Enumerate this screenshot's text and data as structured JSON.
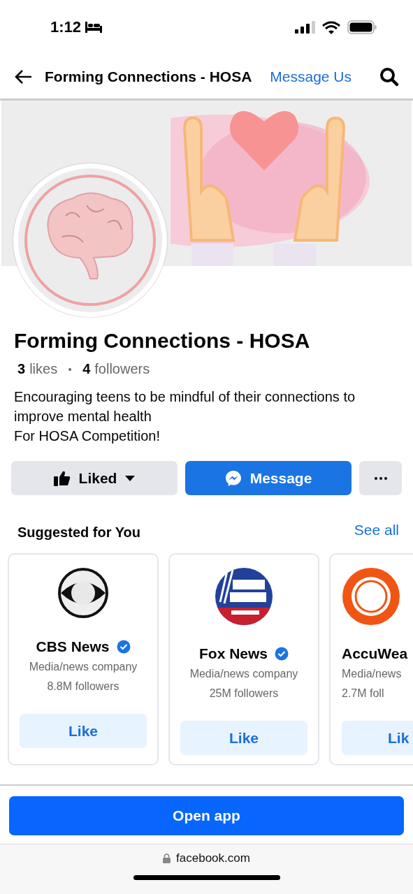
{
  "status_bar": {
    "time": "1:12"
  },
  "nav": {
    "title": "Forming Connections - HOSA",
    "action": "Message Us"
  },
  "profile": {
    "name": "Forming Connections - HOSA",
    "likes_count": "3",
    "likes_label": "likes",
    "followers_count": "4",
    "followers_label": "followers",
    "bio": [
      "Encouraging teens to be mindful of their connections to improve mental health",
      "For HOSA Competition!"
    ]
  },
  "actions": [
    {
      "kind": "liked",
      "label": "Liked"
    },
    {
      "kind": "message",
      "label": "Message"
    },
    {
      "kind": "more"
    }
  ],
  "suggested": {
    "title": "Suggested for You",
    "see_all": "See all",
    "cards": [
      {
        "kind": "full",
        "logo": {
          "kind": "eye"
        },
        "name": "CBS News",
        "verified": true,
        "category": "Media/news company",
        "followers": "8.8M followers",
        "button": "Like"
      },
      {
        "kind": "full",
        "logo": {
          "kind": "globe"
        },
        "name": "Fox News",
        "verified": true,
        "category": "Media/news company",
        "followers": "25M followers",
        "button": "Like"
      },
      {
        "kind": "partial",
        "logo": {
          "kind": "sun"
        },
        "name": "AccuWea",
        "verified": false,
        "category": "Media/news",
        "followers": "2.7M foll",
        "button": "Lik"
      }
    ]
  },
  "open_app": "Open app",
  "url": "facebook.com"
}
